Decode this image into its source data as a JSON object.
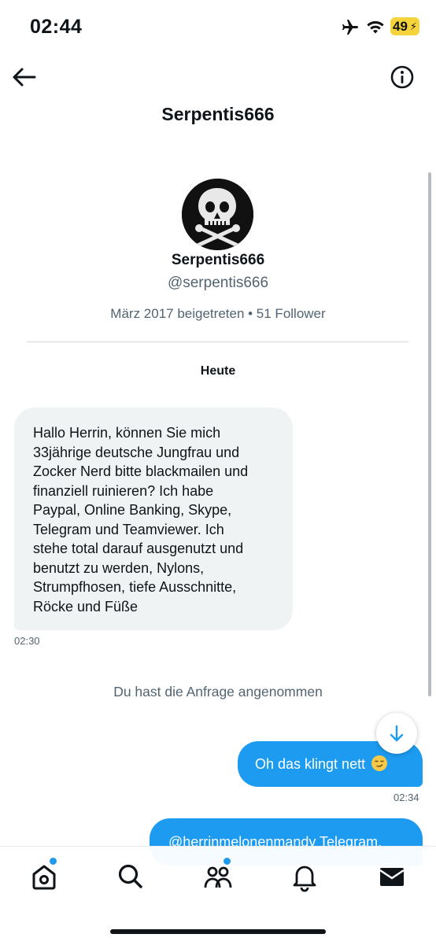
{
  "status_bar": {
    "time": "02:44",
    "battery": "49"
  },
  "header": {
    "title": "Serpentis666"
  },
  "profile": {
    "name": "Serpentis666",
    "handle": "@serpentis666",
    "meta": "März 2017 beigetreten • 51 Follower"
  },
  "conversation": {
    "date_separator": "Heute",
    "messages": [
      {
        "direction": "incoming",
        "lines": [
          "Hallo Herrin, können Sie mich",
          "33jährige deutsche Jungfrau und",
          "Zocker Nerd bitte blackmailen und",
          "finanziell ruinieren? Ich habe",
          "Paypal, Online Banking, Skype,",
          "Telegram und Teamviewer. Ich",
          "stehe total darauf ausgenutzt und",
          "benutzt zu werden, Nylons,",
          "Strumpfhosen, tiefe Ausschnitte,",
          "Röcke und Füße"
        ],
        "time": "02:30"
      },
      {
        "direction": "system",
        "text": "Du hast die Anfrage angenommen"
      },
      {
        "direction": "outgoing",
        "text": "Oh das klingt nett",
        "emoji": "smirking-face",
        "time": "02:34"
      },
      {
        "direction": "outgoing",
        "text": "@herrinmelonenmandy Telegram."
      }
    ]
  },
  "tab_bar": {
    "items": [
      {
        "icon": "home-icon",
        "badge": true
      },
      {
        "icon": "search-icon",
        "badge": false
      },
      {
        "icon": "communities-icon",
        "badge": true
      },
      {
        "icon": "notifications-icon",
        "badge": false
      },
      {
        "icon": "messages-icon",
        "badge": false
      }
    ]
  },
  "colors": {
    "accent": "#1d9bf0",
    "bubble_in": "#eff3f4",
    "muted_text": "#536471",
    "battery": "#f4d43a"
  }
}
